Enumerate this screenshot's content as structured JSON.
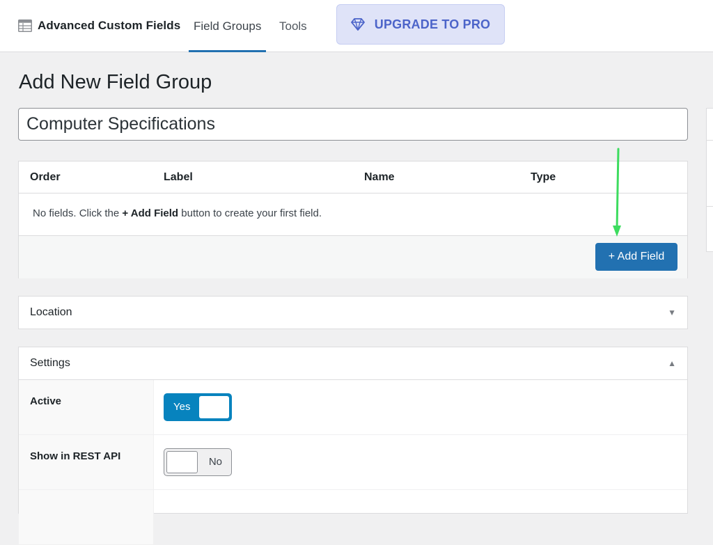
{
  "header": {
    "brand_name": "Advanced Custom Fields",
    "brand_icon": "table-grid-icon",
    "nav": [
      {
        "label": "Field Groups",
        "active": true
      },
      {
        "label": "Tools",
        "active": false
      }
    ],
    "upgrade": {
      "label": "UPGRADE TO PRO",
      "icon": "diamond-icon",
      "color": "#4c64c9"
    }
  },
  "main": {
    "page_title": "Add New Field Group",
    "title_input_value": "Computer Specifications",
    "fields_table": {
      "columns": [
        "Order",
        "Label",
        "Name",
        "Type"
      ],
      "empty_message": {
        "before": "No fields. Click the ",
        "bold": "+ Add Field",
        "after": " button to create your first field."
      },
      "add_field_label": "+ Add Field"
    },
    "location_panel": {
      "title": "Location",
      "collapsed": true
    },
    "settings_panel": {
      "title": "Settings",
      "rows": [
        {
          "label": "Active",
          "toggle_text": "Yes",
          "on": true
        },
        {
          "label": "Show in REST API",
          "toggle_text": "No",
          "on": false
        }
      ]
    }
  },
  "colors": {
    "primary_button": "#2271b1",
    "switch_on": "#0783be",
    "annotation_arrow": "#3ddc5f"
  }
}
